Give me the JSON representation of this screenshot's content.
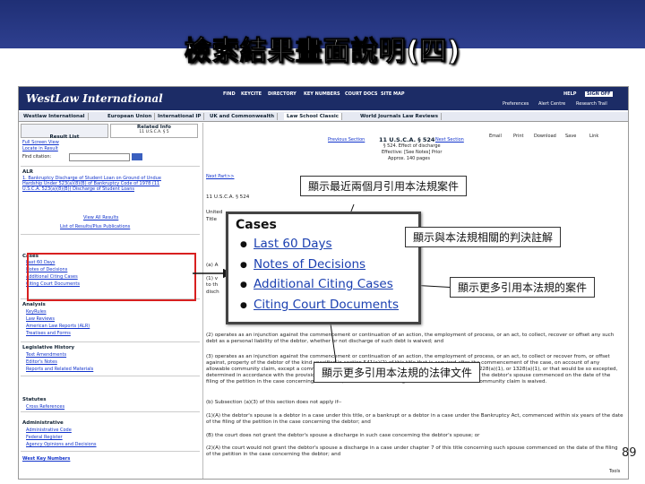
{
  "slide": {
    "title": "檢索結果畫面說明(四)",
    "page_number": "89"
  },
  "app": {
    "logo": "WestLaw International",
    "top_nav": [
      "FIND",
      "KEYCITE",
      "DIRECTORY",
      "KEY NUMBERS",
      "COURT DOCS",
      "SITE MAP"
    ],
    "right_nav": [
      "HELP",
      "SIGN OFF"
    ],
    "sub_nav": [
      "Preferences",
      "Alert Centre",
      "Research Trail"
    ],
    "tabs": [
      "Westlaw International",
      "European Union",
      "International IP",
      "UK and Commonwealth",
      "Law School Classic",
      "World Journals Law Reviews"
    ]
  },
  "left_panel": {
    "tab_result": "Result List",
    "tab_related": "Related Info",
    "tab_related_sub": "11 U.S.C.A. § 5",
    "links_top": [
      "Full Screen View",
      "Locate in Result"
    ],
    "find_label": "Find citation:",
    "alr_header": "ALR",
    "alr_item": "1. Bankruptcy Discharge of Student Loan on Ground of Undue Hardship Under 523(a)(8)(B) of Bankruptcy Code of 1978 (11 U.S.C.A. 523(a)(8)(B)) Discharge of Student Loans",
    "view_all": "View All Results",
    "list_pubs": "List of Results/Plus Publications",
    "cases_header": "Cases",
    "cases_items": [
      "Last 60 Days",
      "Notes of Decisions",
      "Additional Citing Cases",
      "Citing Court Documents"
    ],
    "analysis_header": "Analysis",
    "analysis_items": [
      "KeyRules",
      "Law Reviews",
      "American Law Reports (ALR)",
      "Treatises and Forms"
    ],
    "leg_header": "Legislative History",
    "leg_items": [
      "Text Amendments",
      "Editor's Notes",
      "Reports and Related Materials"
    ],
    "statutes_header": "Statutes",
    "statutes_items": [
      "Cross References"
    ],
    "admin_header": "Administrative",
    "admin_items": [
      "Administrative Code",
      "Federal Register",
      "Agency Opinions and Decisions"
    ],
    "west_key": "West Key Numbers"
  },
  "main": {
    "prev": "Previous Section",
    "citation": "11 U.S.C.A. § 524",
    "next": "Next Section",
    "toolbar": [
      "Email",
      "Print",
      "Download",
      "Save",
      "Link"
    ],
    "effect": "§ 524. Effect of discharge",
    "status_line": "Effective: [See Notes] Prior",
    "approx": "Approx. 140 pages",
    "next_part": "Next Part>>",
    "usca": "11 U.S.C.A. § 524",
    "united": "United",
    "title_frag": "Title",
    "para_a": "(a) A",
    "para1": "(1) v",
    "para_to": "to th",
    "para_disch": "disch",
    "body_1": "(2) operates as an injunction against the commencement or continuation of an action, the employment of process, or an act, to collect, recover or offset any such debt as a personal liability of the debtor, whether or not discharge of such debt is waived; and",
    "body_2": "(3) operates as an injunction against the commencement or continuation of an action, the employment of process, or an act, to collect or recover from, or offset against, property of the debtor of the kind specified in section 541(a)(2) of this title that is acquired after the commencement of the case, on account of any allowable community claim, except a community claim that is excepted from discharge under section 523, 1228(a)(1), or 1328(a)(1), or that would be so excepted, determined in accordance with the provisions of sections 523(c) and 523(d) of this title, in a case concerning the debtor's spouse commenced on the date of the filing of the petition in the case concerning the debtor, whether or not discharge of the debt based on such community claim is waived.",
    "body_3": "(b) Subsection (a)(3) of this section does not apply if--",
    "body_4": "(1)(A) the debtor's spouse is a debtor in a case under this title, or a bankrupt or a debtor in a case under the Bankruptcy Act, commenced within six years of the date of the filing of the petition in the case concerning the debtor; and",
    "body_5": "(B) the court does not grant the debtor's spouse a discharge in such case concerning the debtor's spouse; or",
    "body_6": "(2)(A) the court would not grant the debtor's spouse a discharge in a case under chapter 7 of this title concerning such spouse commenced on the date of the filing of the petition in the case concerning the debtor; and",
    "tools": "Tools"
  },
  "zoom": {
    "title": "Cases",
    "items": [
      "Last 60 Days",
      "Notes of Decisions",
      "Additional Citing Cases",
      "Citing Court Documents"
    ]
  },
  "callouts": {
    "c1": "顯示最近兩個月引用本法規案件",
    "c2": "顯示與本法規相關的判決註解",
    "c3": "顯示更多引用本法規的案件",
    "c4": "顯示更多引用本法規的法律文件"
  },
  "colors": {
    "banner": "#1f2f75",
    "link": "#1a3fb0",
    "highlight_box": "#d82020"
  }
}
